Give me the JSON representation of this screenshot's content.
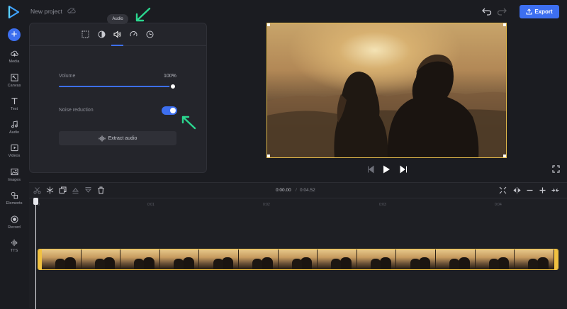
{
  "header": {
    "project_title": "New project",
    "export_label": "Export"
  },
  "sidebar": {
    "items": [
      {
        "label": "Media",
        "icon": "cloud-upload-icon"
      },
      {
        "label": "Canvas",
        "icon": "canvas-resize-icon"
      },
      {
        "label": "Text",
        "icon": "text-icon"
      },
      {
        "label": "Audio",
        "icon": "music-note-icon"
      },
      {
        "label": "Videos",
        "icon": "video-icon"
      },
      {
        "label": "Images",
        "icon": "image-icon"
      },
      {
        "label": "Elements",
        "icon": "shapes-icon"
      },
      {
        "label": "Record",
        "icon": "record-icon"
      },
      {
        "label": "TTS",
        "icon": "waveform-icon"
      }
    ]
  },
  "panel": {
    "tabs": [
      "crop-icon",
      "filter-icon",
      "audio-icon",
      "speed-icon",
      "duration-icon"
    ],
    "active_tab": "audio-icon",
    "tooltip": "Audio",
    "volume_label": "Volume",
    "volume_value": "100%",
    "volume_level": 1.0,
    "noise_label": "Noise reduction",
    "noise_on": true,
    "extract_label": "Extract audio"
  },
  "timeline": {
    "current_time": "0:00.00",
    "separator": "/",
    "total_time": "0:04.52",
    "ticks": [
      "0",
      "0:01",
      "0:02",
      "0:03",
      "0:04"
    ]
  },
  "colors": {
    "accent": "#3d6ff0",
    "clip_border": "#f0c141",
    "annotation_arrow": "#2bd68f"
  }
}
